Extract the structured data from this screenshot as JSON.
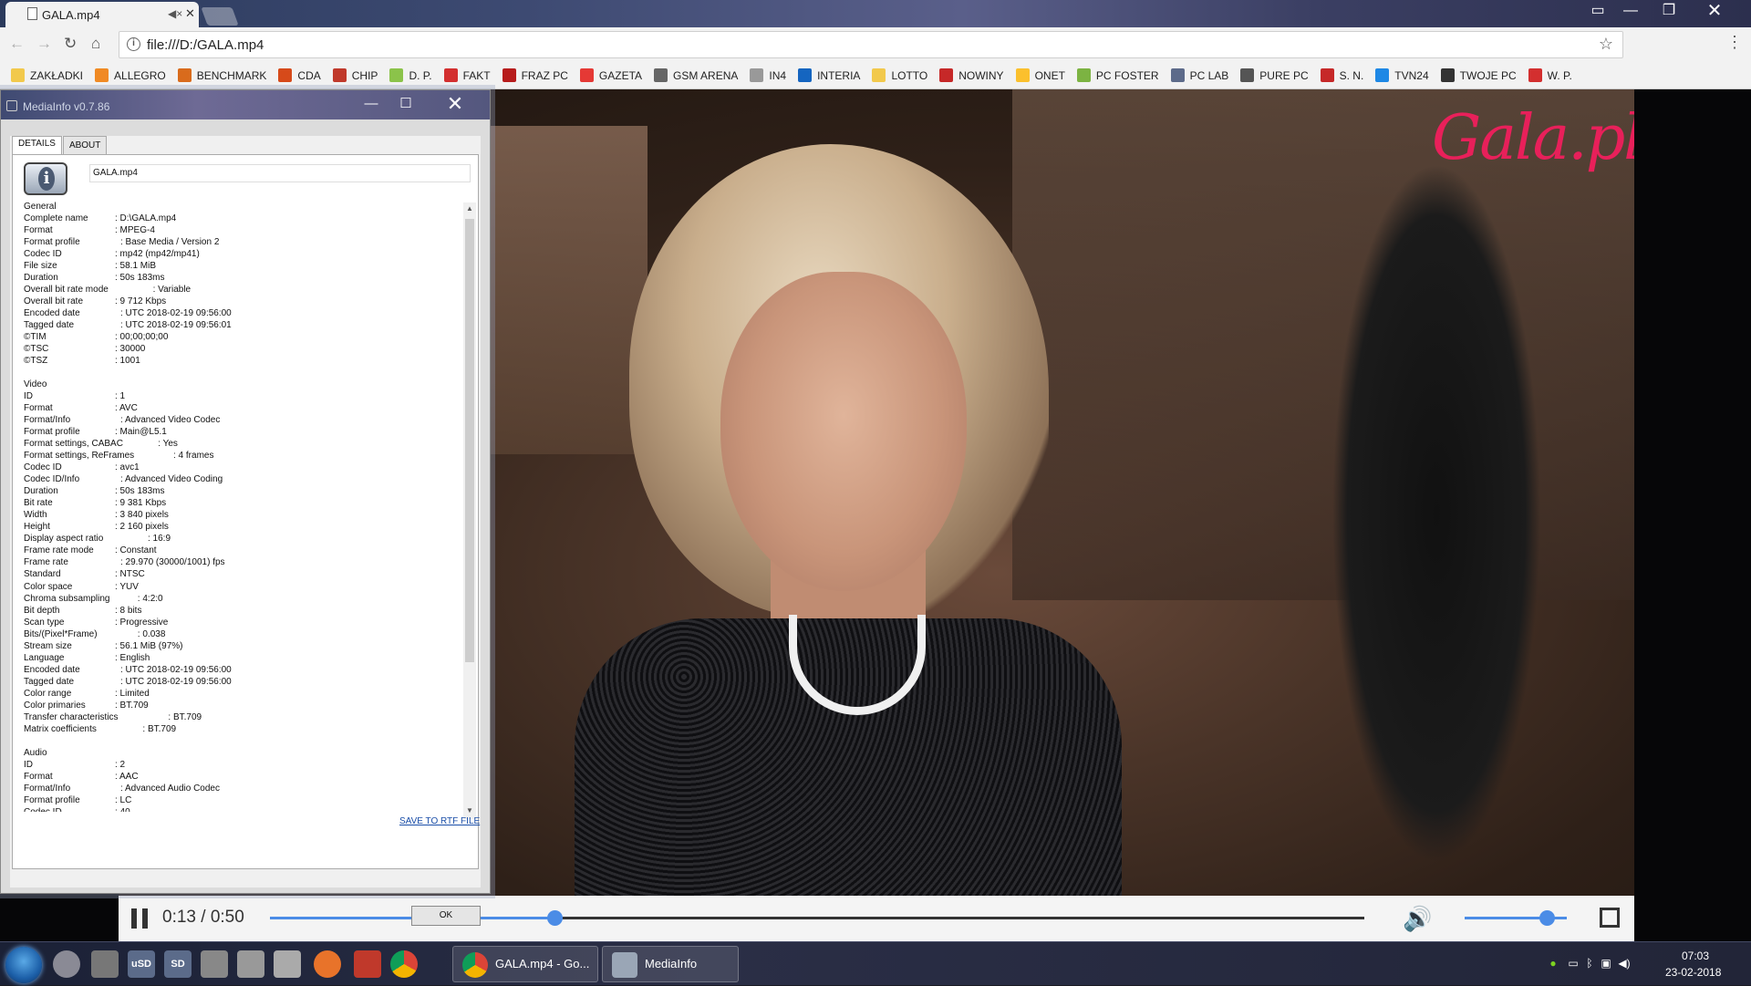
{
  "browser": {
    "tab_title": "GALA.mp4",
    "url": "file:///D:/GALA.mp4",
    "bookmarks": [
      "ZAKŁADKI",
      "ALLEGRO",
      "BENCHMARK",
      "CDA",
      "CHIP",
      "D. P.",
      "FAKT",
      "FRAZ PC",
      "GAZETA",
      "GSM ARENA",
      "IN4",
      "INTERIA",
      "LOTTO",
      "NOWINY",
      "ONET",
      "PC FOSTER",
      "PC LAB",
      "PURE PC",
      "S. N.",
      "TVN24",
      "TWOJE PC",
      "W. P."
    ]
  },
  "video": {
    "logo": "Gala.pl",
    "time": "0:13 / 0:50",
    "progress": 0.26,
    "volume": 0.8
  },
  "mediainfo": {
    "title": "MediaInfo v0.7.86",
    "tabs": [
      "DETAILS",
      "ABOUT"
    ],
    "filename": "GALA.mp4",
    "lines": [
      [
        "General",
        ""
      ],
      [
        "Complete name",
        ": D:\\GALA.mp4"
      ],
      [
        "Format",
        ": MPEG-4"
      ],
      [
        "Format profile",
        ": Base Media / Version 2"
      ],
      [
        "Codec ID",
        ": mp42 (mp42/mp41)"
      ],
      [
        "File size",
        ": 58.1 MiB"
      ],
      [
        "Duration",
        ": 50s 183ms"
      ],
      [
        "Overall bit rate mode",
        ": Variable"
      ],
      [
        "Overall bit rate",
        ": 9 712 Kbps"
      ],
      [
        "Encoded date",
        ": UTC 2018-02-19 09:56:00"
      ],
      [
        "Tagged date",
        ": UTC 2018-02-19 09:56:01"
      ],
      [
        "©TIM",
        ": 00;00;00;00"
      ],
      [
        "©TSC",
        ": 30000"
      ],
      [
        "©TSZ",
        ": 1001"
      ],
      [
        "",
        ""
      ],
      [
        "Video",
        ""
      ],
      [
        "ID",
        ": 1"
      ],
      [
        "Format",
        ": AVC"
      ],
      [
        "Format/Info",
        ": Advanced Video Codec"
      ],
      [
        "Format profile",
        ": Main@L5.1"
      ],
      [
        "Format settings, CABAC",
        ": Yes"
      ],
      [
        "Format settings, ReFrames",
        ": 4 frames"
      ],
      [
        "Codec ID",
        ": avc1"
      ],
      [
        "Codec ID/Info",
        ": Advanced Video Coding"
      ],
      [
        "Duration",
        ": 50s 183ms"
      ],
      [
        "Bit rate",
        ": 9 381 Kbps"
      ],
      [
        "Width",
        ": 3 840 pixels"
      ],
      [
        "Height",
        ": 2 160 pixels"
      ],
      [
        "Display aspect ratio",
        ": 16:9"
      ],
      [
        "Frame rate mode",
        ": Constant"
      ],
      [
        "Frame rate",
        ": 29.970 (30000/1001) fps"
      ],
      [
        "Standard",
        ": NTSC"
      ],
      [
        "Color space",
        ": YUV"
      ],
      [
        "Chroma subsampling",
        ": 4:2:0"
      ],
      [
        "Bit depth",
        ": 8 bits"
      ],
      [
        "Scan type",
        ": Progressive"
      ],
      [
        "Bits/(Pixel*Frame)",
        ": 0.038"
      ],
      [
        "Stream size",
        ": 56.1 MiB (97%)"
      ],
      [
        "Language",
        ": English"
      ],
      [
        "Encoded date",
        ": UTC 2018-02-19 09:56:00"
      ],
      [
        "Tagged date",
        ": UTC 2018-02-19 09:56:00"
      ],
      [
        "Color range",
        ": Limited"
      ],
      [
        "Color primaries",
        ": BT.709"
      ],
      [
        "Transfer characteristics",
        ": BT.709"
      ],
      [
        "Matrix coefficients",
        ": BT.709"
      ],
      [
        "",
        ""
      ],
      [
        "Audio",
        ""
      ],
      [
        "ID",
        ": 2"
      ],
      [
        "Format",
        ": AAC"
      ],
      [
        "Format/Info",
        ": Advanced Audio Codec"
      ],
      [
        "Format profile",
        ": LC"
      ],
      [
        "Codec ID",
        ": 40"
      ]
    ],
    "save_link": "SAVE TO RTF FILE",
    "ok_label": "OK"
  },
  "taskbar": {
    "tasks": [
      {
        "label": "GALA.mp4 - Go..."
      },
      {
        "label": "MediaInfo"
      }
    ],
    "clock_time": "07:03",
    "clock_date": "23-02-2018"
  }
}
